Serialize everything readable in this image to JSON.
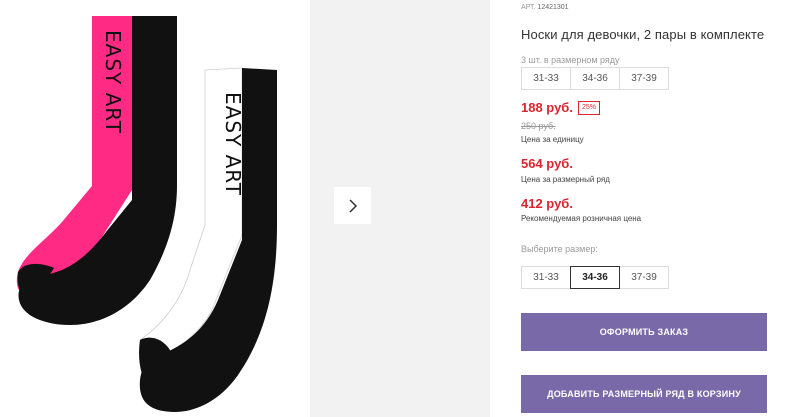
{
  "colors": {
    "accent_purple": "#7a69a8",
    "price_red": "#d9252e",
    "sock_pink": "#ff2a84",
    "sock_black": "#111111",
    "sock_white": "#ffffff"
  },
  "gallery": {
    "image_text": "EASY ART",
    "next_icon": "chevron-right-icon"
  },
  "product": {
    "article_label": "АРТ.",
    "article_number": "12421301",
    "title": "Носки для девочки, 2 пары в комплекте"
  },
  "size_pack": {
    "label": "3 шт. в размерном ряду",
    "sizes": [
      "31-33",
      "34-36",
      "37-39"
    ]
  },
  "pricing": {
    "unit_price": "188 руб.",
    "discount": "25%",
    "old_price": "250 руб.",
    "unit_caption": "Цена за единицу",
    "pack_price": "564 руб.",
    "pack_caption": "Цена за размерный ряд",
    "retail_price": "412 руб.",
    "retail_caption": "Рекомендуемая розничная цена"
  },
  "size_select": {
    "label": "Выберите размер:",
    "sizes": [
      "31-33",
      "34-36",
      "37-39"
    ],
    "selected": "34-36"
  },
  "buttons": {
    "order": "ОФОРМИТЬ ЗАКАЗ",
    "add_pack": "ДОБАВИТЬ РАЗМЕРНЫЙ РЯД В КОРЗИНУ"
  }
}
